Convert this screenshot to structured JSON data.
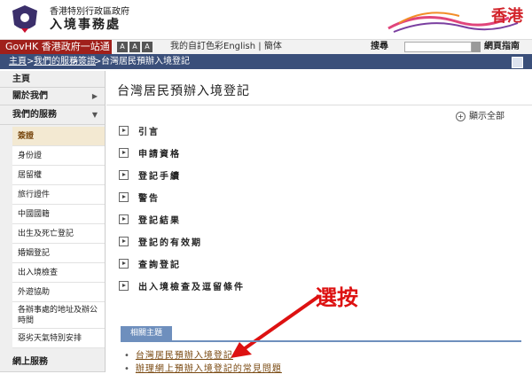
{
  "header": {
    "dept_line1": "香港特別行政區政府",
    "dept_line2": "入境事務處",
    "brand_text": "香港"
  },
  "topbar": {
    "govhk": "GovHK 香港政府一站通",
    "font_sizes": [
      "A",
      "A",
      "A"
    ],
    "my_colors": "我的自訂色彩",
    "lang": "English | 簡体",
    "search_label": "搜尋",
    "search_value": "",
    "site_guide": "網頁指南"
  },
  "breadcrumb": {
    "home": "主頁",
    "our_services": "我們的服務",
    "visas": "簽證",
    "current": "台灣居民預辦入境登記"
  },
  "sidebar": {
    "top_items": [
      {
        "label": "主頁"
      },
      {
        "label": "關於我們",
        "arrow": "▶"
      },
      {
        "label": "我們的服務",
        "arrow": "▼"
      }
    ],
    "sub_items": [
      "簽證",
      "身份證",
      "居留權",
      "旅行證件",
      "中國國籍",
      "出生及死亡登記",
      "婚姻登記",
      "出入境檢查",
      "外遊協助",
      "各辦事處的地址及辦公時間",
      "惡劣天氣特別安排"
    ],
    "bottom_item": "網上服務"
  },
  "content": {
    "title": "台灣居民預辦入境登記",
    "show_all": "顯示全部",
    "sections": [
      "引言",
      "申請資格",
      "登記手續",
      "警告",
      "登記結果",
      "登記的有效期",
      "查詢登記",
      "出入境檢查及逗留條件"
    ],
    "annotation": "選按",
    "related_tab": "相關主題",
    "related_items": [
      "台灣居民預辦入境登記",
      "辦理網上預辦入境登記的常見問題"
    ],
    "colors": {
      "annotation": "#dd1111",
      "nav_bar": "#3a4f7a",
      "govhk": "#a0201b",
      "link": "#7a4a12"
    }
  }
}
